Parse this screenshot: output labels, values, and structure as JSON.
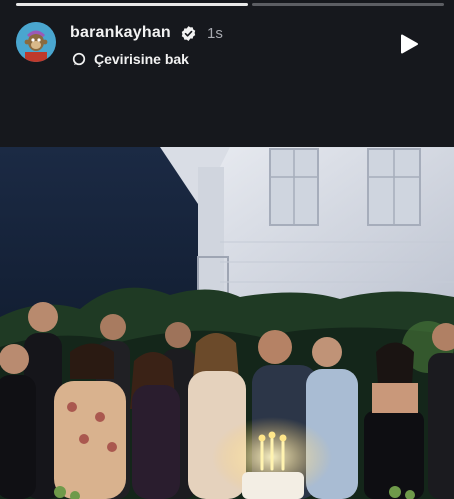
{
  "story": {
    "progress": {
      "segments": 2,
      "current_segment": 1
    },
    "user": {
      "username": "barankayhan",
      "verified": true,
      "time_ago": "1s",
      "avatar_icon": "monkey-avatar-icon"
    },
    "translate_label": "Çevirisine bak",
    "controls": {
      "play_icon": "play-icon",
      "more_icon": "more-options-icon"
    }
  },
  "colors": {
    "background": "#16181d",
    "text": "#f2f2f2",
    "muted": "#a8aab0",
    "progress_done": "#e8e8e8",
    "progress_rest": "#5c5e63"
  }
}
